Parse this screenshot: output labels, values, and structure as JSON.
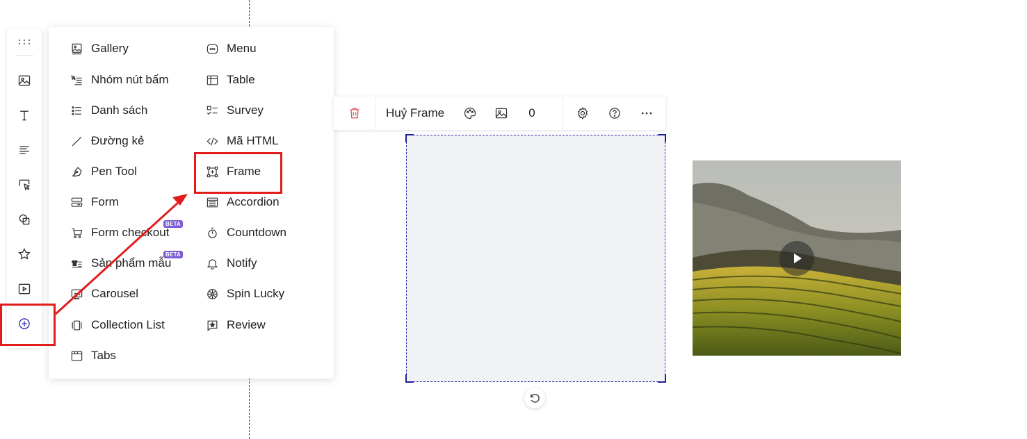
{
  "menu": {
    "left": [
      {
        "label": "Gallery",
        "icon": "gallery-icon"
      },
      {
        "label": "Nhóm nút bấm",
        "icon": "button-group-icon"
      },
      {
        "label": "Danh sách",
        "icon": "list-icon"
      },
      {
        "label": "Đường kẻ",
        "icon": "line-icon"
      },
      {
        "label": "Pen Tool",
        "icon": "pen-tool-icon"
      },
      {
        "label": "Form",
        "icon": "form-icon"
      },
      {
        "label": "Form checkout",
        "icon": "cart-icon",
        "badge": "BETA"
      },
      {
        "label": "Sản phẩm mẫu",
        "icon": "product-icon",
        "badge": "BETA"
      },
      {
        "label": "Carousel",
        "icon": "carousel-icon"
      },
      {
        "label": "Collection List",
        "icon": "collection-icon"
      },
      {
        "label": "Tabs",
        "icon": "tabs-icon"
      }
    ],
    "right": [
      {
        "label": "Menu",
        "icon": "menu-icon"
      },
      {
        "label": "Table",
        "icon": "table-icon"
      },
      {
        "label": "Survey",
        "icon": "survey-icon"
      },
      {
        "label": "Mã HTML",
        "icon": "code-icon"
      },
      {
        "label": "Frame",
        "icon": "frame-icon"
      },
      {
        "label": "Accordion",
        "icon": "accordion-icon"
      },
      {
        "label": "Countdown",
        "icon": "timer-icon"
      },
      {
        "label": "Notify",
        "icon": "bell-icon"
      },
      {
        "label": "Spin Lucky",
        "icon": "spin-icon"
      },
      {
        "label": "Review",
        "icon": "review-icon"
      }
    ]
  },
  "element_toolbar": {
    "unframe_label": "Huỷ Frame",
    "image_count": "0"
  },
  "colors": {
    "accent": "#2b2bb0",
    "highlight": "#e21b1b",
    "delete": "#e05a5a",
    "beta": "#7b5cd6"
  }
}
